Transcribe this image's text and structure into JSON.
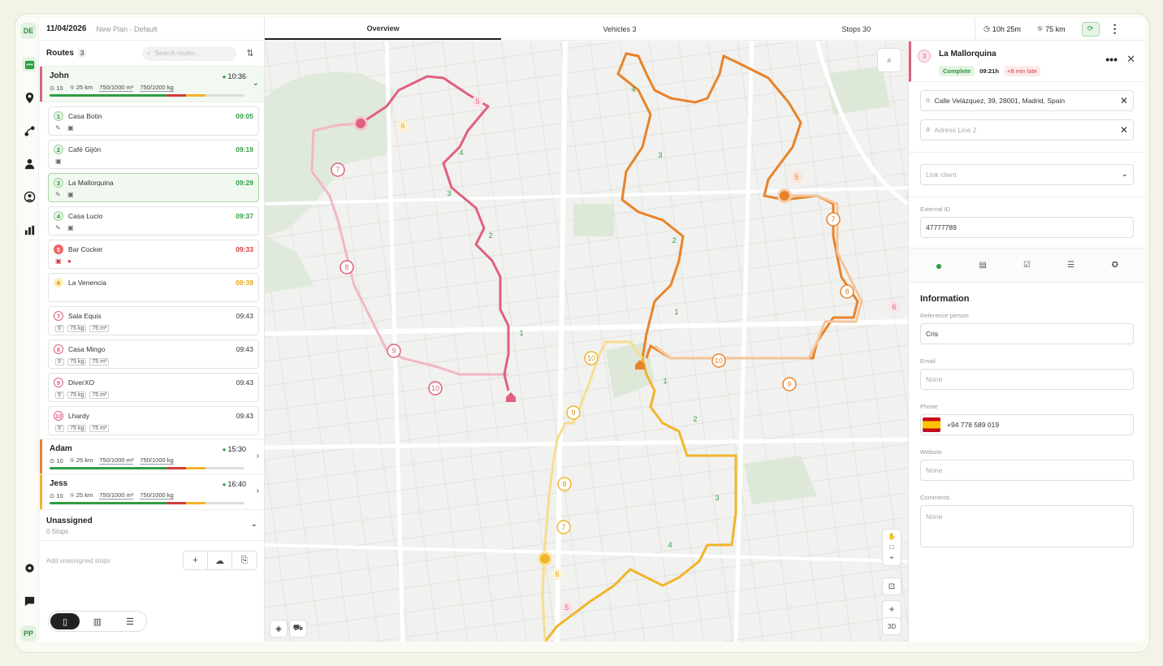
{
  "header": {
    "date": "11/04/2026",
    "plan": "New Plan - Default",
    "tabs": [
      {
        "label": "Overview"
      },
      {
        "label": "Vehicles 3"
      },
      {
        "label": "Stops 30"
      }
    ],
    "duration": "10h 25m",
    "distance": "75 km"
  },
  "rail": {
    "top_badge": "DE",
    "bottom_badge": "PP"
  },
  "routes": {
    "title": "Routes",
    "count": "3",
    "search_placeholder": "Search routes...",
    "items": [
      {
        "name": "John",
        "time": "10:36",
        "stops": "10",
        "km": "25 km",
        "volume": "750/1000 m³",
        "weight": "750/1000 kg",
        "color": "#e0607e"
      },
      {
        "name": "Adam",
        "time": "15:30",
        "stops": "10",
        "km": "25 km",
        "volume": "750/1000 m³",
        "weight": "750/1000 kg",
        "color": "#e8832a"
      },
      {
        "name": "Jess",
        "time": "16:40",
        "stops": "10",
        "km": "25 km",
        "volume": "750/1000 m³",
        "weight": "750/1000 kg",
        "color": "#f1b52b"
      }
    ],
    "stops": [
      {
        "n": "1",
        "name": "Casa Botin",
        "time": "09:05"
      },
      {
        "n": "2",
        "name": "Café Gijón",
        "time": "09:19"
      },
      {
        "n": "3",
        "name": "La Mallorquina",
        "time": "09:29"
      },
      {
        "n": "4",
        "name": "Casa Lucio",
        "time": "09:37"
      },
      {
        "n": "5",
        "name": "Bar Cocker",
        "time": "09:33"
      },
      {
        "n": "6",
        "name": "La Venencia",
        "time": "09:39"
      },
      {
        "n": "7",
        "name": "Sala Equis",
        "time": "09:43"
      },
      {
        "n": "8",
        "name": "Casa Mingo",
        "time": "09:43"
      },
      {
        "n": "9",
        "name": "DiverXO",
        "time": "09:43"
      },
      {
        "n": "10",
        "name": "Lhardy",
        "time": "09:43"
      }
    ],
    "tag_time": "5'",
    "tag_kg": "75 kg",
    "tag_m3": "75 m³",
    "unassigned_title": "Unassigned",
    "unassigned_sub": "0 Stops",
    "add_unassigned": "Add unassigned stops"
  },
  "map": {
    "btn_3d": "3D"
  },
  "detail": {
    "num": "3",
    "title": "La Mallorquina",
    "status": "Complete",
    "eta": "09:21h",
    "late": "+8 min late",
    "address1": "Calle Velázquez, 39, 28001, Madrid, Spain",
    "address2_placeholder": "Adress Line 2",
    "link_client_placeholder": "Link client",
    "external_id_label": "External ID",
    "external_id": "47777789",
    "info_title": "Information",
    "ref_label": "Reference person",
    "ref_value": "Cris",
    "email_label": "Email",
    "email_placeholder": "None",
    "phone_label": "Phone",
    "phone_value": "+94 778 589 019",
    "website_label": "Website",
    "website_placeholder": "None",
    "comments_label": "Comments",
    "comments_placeholder": "None"
  }
}
